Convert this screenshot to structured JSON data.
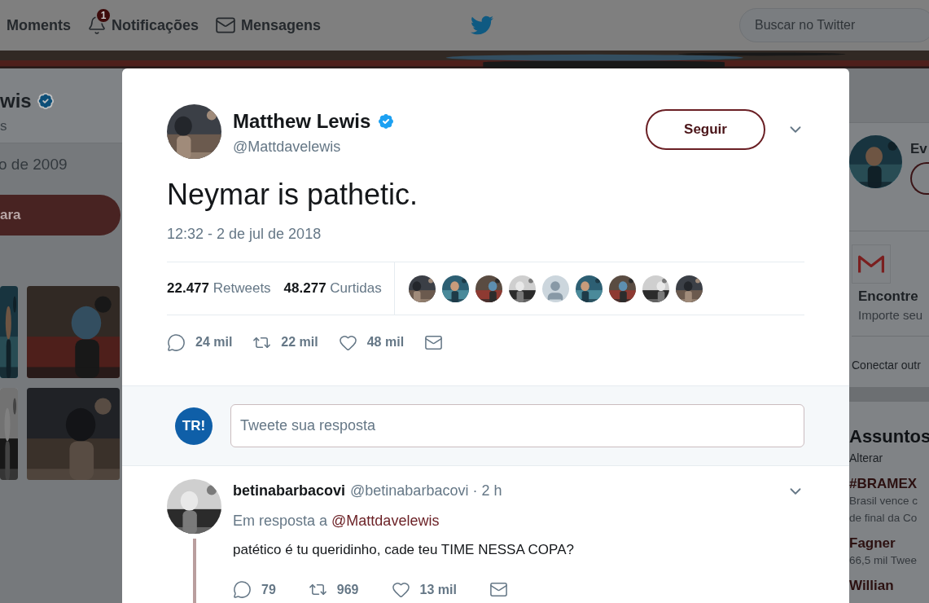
{
  "nav": {
    "items": [
      {
        "label": "Moments",
        "kind": "plain"
      },
      {
        "label": "Notificações",
        "kind": "notifications",
        "badge": "1"
      },
      {
        "label": "Mensagens",
        "kind": "messages"
      }
    ],
    "search": {
      "placeholder": "Buscar no Twitter"
    }
  },
  "profile_card": {
    "name": "wis",
    "verified": true,
    "handle": "s",
    "joined": "o de 2009",
    "button": "ara"
  },
  "media": [
    {
      "kind": "picture"
    },
    {
      "kind": "picture"
    },
    {
      "kind": "picture"
    },
    {
      "kind": "picture"
    }
  ],
  "sidebar_right": {
    "suggestion": {
      "name": "Ev"
    },
    "gmail": {
      "title": "Encontre",
      "subtitle": "Importe seu"
    },
    "connect": "Conectar outr",
    "trends": {
      "title": "Assuntos",
      "change": "Alterar",
      "items": [
        {
          "name": "#BRAMEX",
          "lines": [
            "Brasil vence c",
            "de final da Co"
          ]
        },
        {
          "name": "Fagner",
          "lines": [
            "66,5 mil Twee"
          ]
        },
        {
          "name": "Willian"
        }
      ]
    }
  },
  "tweet": {
    "name": "Matthew Lewis",
    "verified": true,
    "handle": "@Mattdavelewis",
    "follow_button": "Seguir",
    "text": "Neymar is pathetic.",
    "timestamp": "12:32 - 2 de jul de 2018",
    "retweets": {
      "count": "22.477",
      "label": "Retweets"
    },
    "likes": {
      "count": "48.277",
      "label": "Curtidas"
    },
    "likers": [
      {
        "kind": "picture"
      },
      {
        "kind": "picture"
      },
      {
        "kind": "picture"
      },
      {
        "kind": "picture"
      },
      {
        "kind": "default"
      },
      {
        "kind": "picture"
      },
      {
        "kind": "picture"
      },
      {
        "kind": "picture"
      },
      {
        "kind": "picture"
      }
    ],
    "actions": [
      {
        "kind": "reply",
        "count": "24 mil"
      },
      {
        "kind": "retweet",
        "count": "22 mil"
      },
      {
        "kind": "like",
        "count": "48 mil"
      },
      {
        "kind": "message"
      }
    ]
  },
  "reply_box": {
    "logo": "TR!",
    "placeholder": "Tweete sua resposta"
  },
  "replies": [
    {
      "name": "betinabarbacovi",
      "handle": "@betinabarbacovi",
      "time": "· 2 h",
      "in_reply_label": "Em resposta a",
      "in_reply_to": "@Mattdavelewis",
      "text": "patético é tu queridinho, cade teu TIME NESSA COPA?",
      "actions": [
        {
          "kind": "reply",
          "count": "79"
        },
        {
          "kind": "retweet",
          "count": "969"
        },
        {
          "kind": "like",
          "count": "13 mil"
        },
        {
          "kind": "message"
        }
      ]
    }
  ]
}
